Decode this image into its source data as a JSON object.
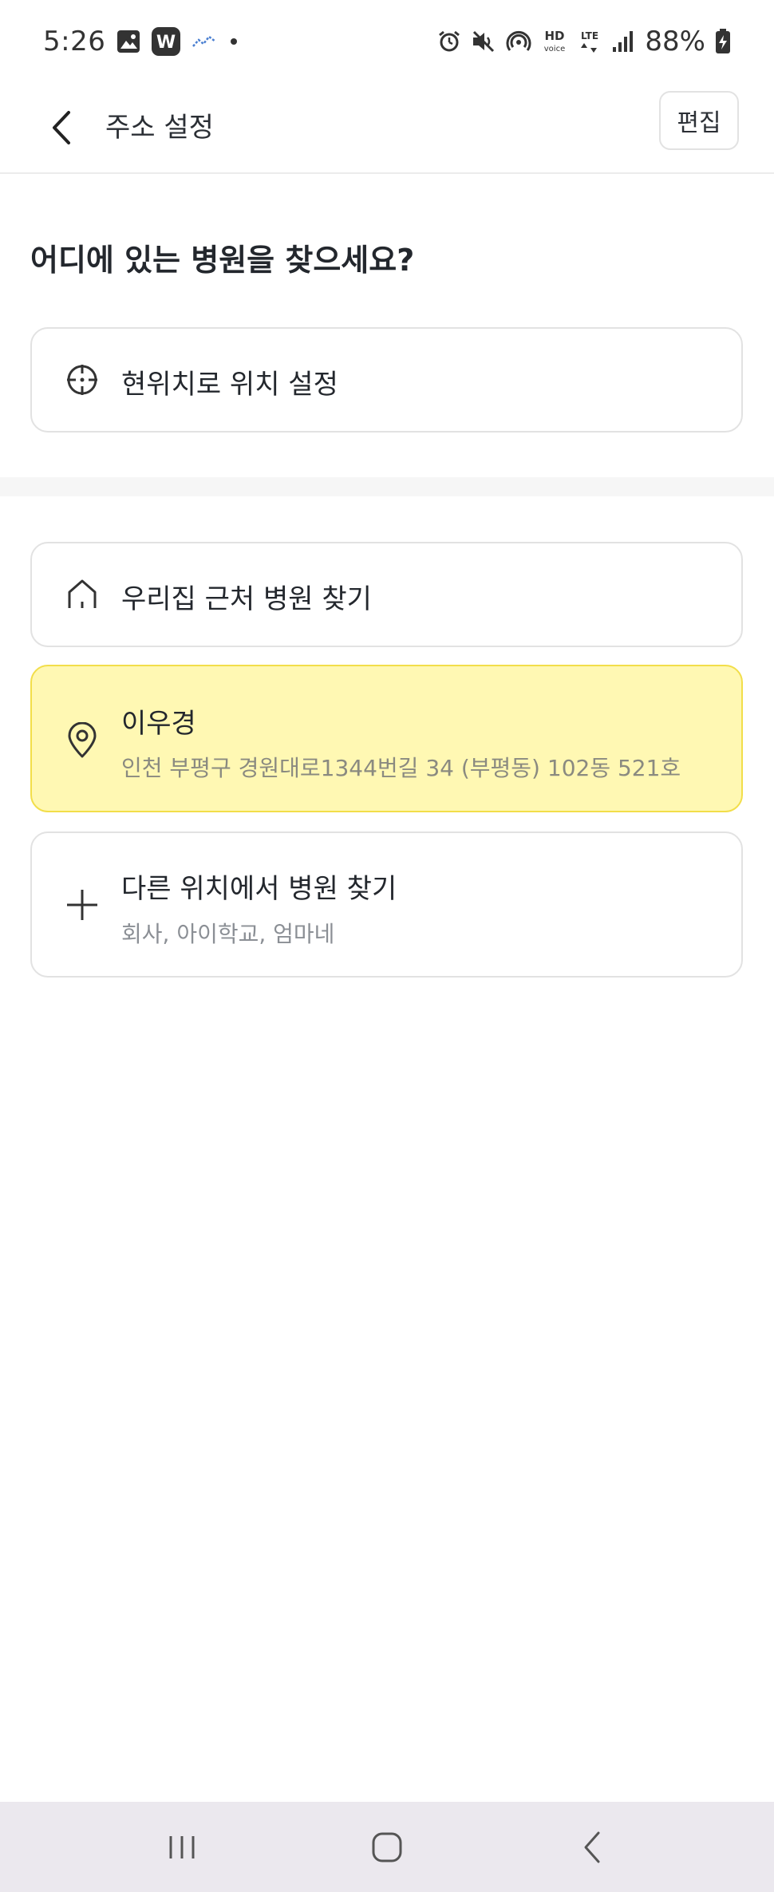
{
  "status_bar": {
    "time": "5:26",
    "battery": "88%",
    "left_icons": [
      "gallery-icon",
      "w-app-icon",
      "chart-icon",
      "dot-icon"
    ],
    "right_icons": [
      "alarm-icon",
      "mute-icon",
      "hotspot-icon",
      "hd-voice-icon",
      "lte-icon",
      "signal-icon",
      "battery-icon"
    ],
    "hd_label": "HD",
    "voice_label": "voice",
    "lte_label": "LTE",
    "w_label": "W"
  },
  "app_bar": {
    "title": "주소 설정",
    "edit_label": "편집"
  },
  "main": {
    "question": "어디에 있는 병원을 찾으세요?",
    "current_location": {
      "label": "현위치로 위치 설정",
      "icon": "crosshair-icon"
    },
    "home": {
      "label": "우리집 근처 병원 찾기",
      "icon": "home-icon"
    },
    "selected_address": {
      "name": "이우경",
      "address": "인천 부평구 경원대로1344번길 34 (부평동) 102동 521호",
      "icon": "location-pin-icon",
      "highlight_color": "#fff8b3"
    },
    "other_location": {
      "label": "다른 위치에서 병원 찾기",
      "sub": "회사, 아이학교, 엄마네",
      "icon": "plus-icon"
    }
  },
  "nav_bar": {
    "buttons": [
      "recent-apps-icon",
      "home-button-icon",
      "back-nav-icon"
    ]
  }
}
